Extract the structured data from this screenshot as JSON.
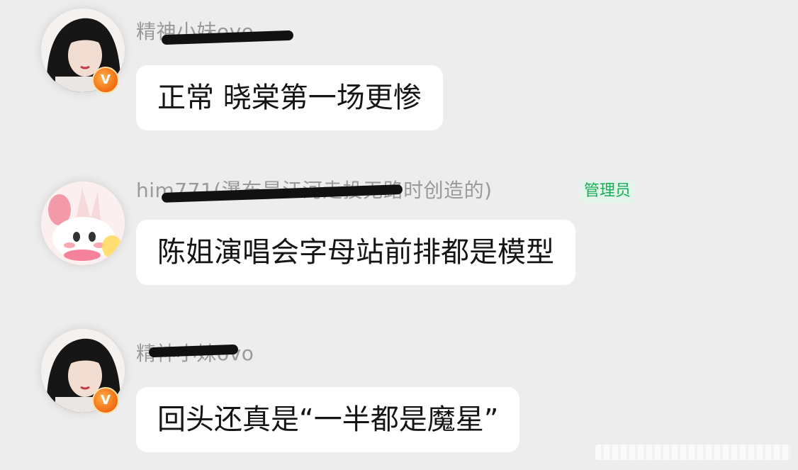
{
  "messages": [
    {
      "username": "精神小妹ovo",
      "text": "正常 晓棠第一场更惨",
      "avatar_icon": "portrait-dark-hair-avatar",
      "badge_icon": "level-badge-icon"
    },
    {
      "username": "him771(瀑布是江河走投无路时创造的)",
      "role_tag": "管理员",
      "text": "陈姐演唱会字母站前排都是模型",
      "avatar_icon": "cartoon-rabbit-avatar"
    },
    {
      "username": "精神小妹ovo",
      "text": "回头还真是“一半都是魔星”",
      "avatar_icon": "portrait-dark-hair-avatar",
      "badge_icon": "level-badge-icon"
    }
  ],
  "colors": {
    "background": "#ededed",
    "bubble": "#ffffff",
    "admin_tag_text": "#1aad55",
    "admin_tag_bg": "#e3f4ea",
    "username": "#9a9a9a",
    "message_text": "#151515"
  }
}
